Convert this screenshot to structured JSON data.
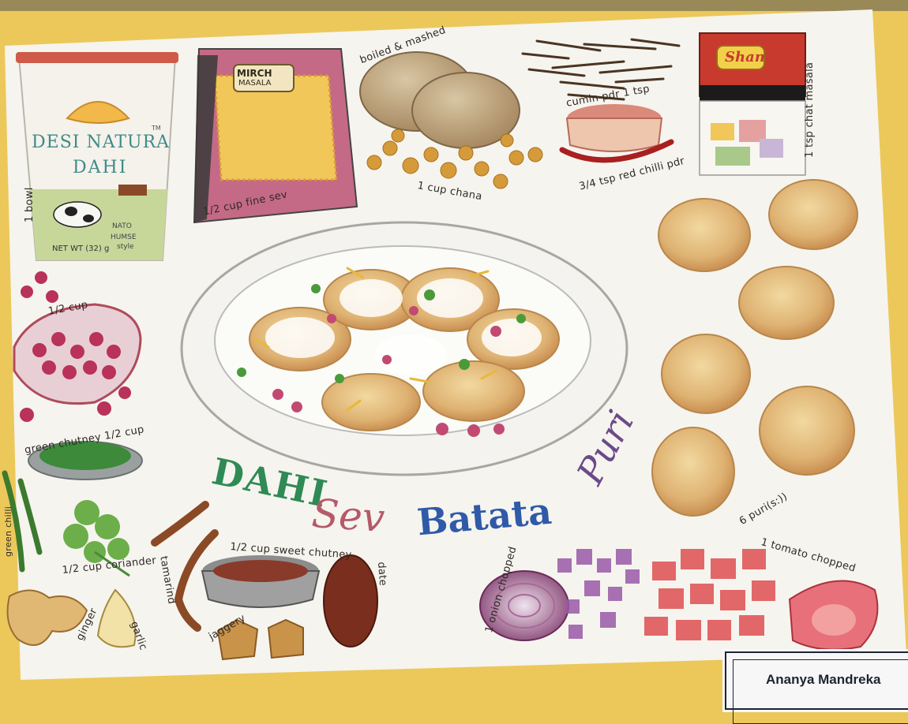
{
  "artwork": {
    "title_words": [
      "DAHI",
      "Sev",
      "Batata",
      "Puri"
    ],
    "artist_name": "Ananya Mandreka",
    "colors": {
      "board": "#ecc85a",
      "paper": "#f6f4ee",
      "title_green": "#2f8a55",
      "title_blue": "#2f5aa8",
      "title_pink": "#b45a6a",
      "title_purple": "#6b4a8a"
    }
  },
  "packages": {
    "dahi_brand_1": "DESI NATURA",
    "dahi_brand_2": "DAHI",
    "dahi_tm": "TM",
    "dahi_fine": "NATO",
    "dahi_style": "HUMSE",
    "dahi_style2": "style",
    "dahi_weight": "NET WT (32) g",
    "sev_brand_1": "MIRCH",
    "sev_brand_2": "MASALA",
    "masala_brand": "Shan"
  },
  "labels": {
    "bowl": "1 bowl",
    "sev": "1/2 cup fine sev",
    "potato": "boiled & mashed",
    "chana": "1 cup chana",
    "cumin": "cumin pdr 1 tsp",
    "chilli": "3/4 tsp red chilli pdr",
    "chat_masala": "1 tsp chat masala",
    "pomegranate": "1/2 cup",
    "green_chutney": "green chutney 1/2 cup",
    "green_chilli": "green chilli",
    "coriander": "1/2 cup coriander",
    "tamarind": "tamarind",
    "sweet_chutney": "1/2 cup sweet chutney",
    "date": "date",
    "jaggery": "jaggery",
    "ginger": "ginger",
    "garlic": "garlic",
    "onion": "1 onion chopped",
    "tomato": "1 tomato chopped",
    "puri": "6 puri(s:))"
  }
}
